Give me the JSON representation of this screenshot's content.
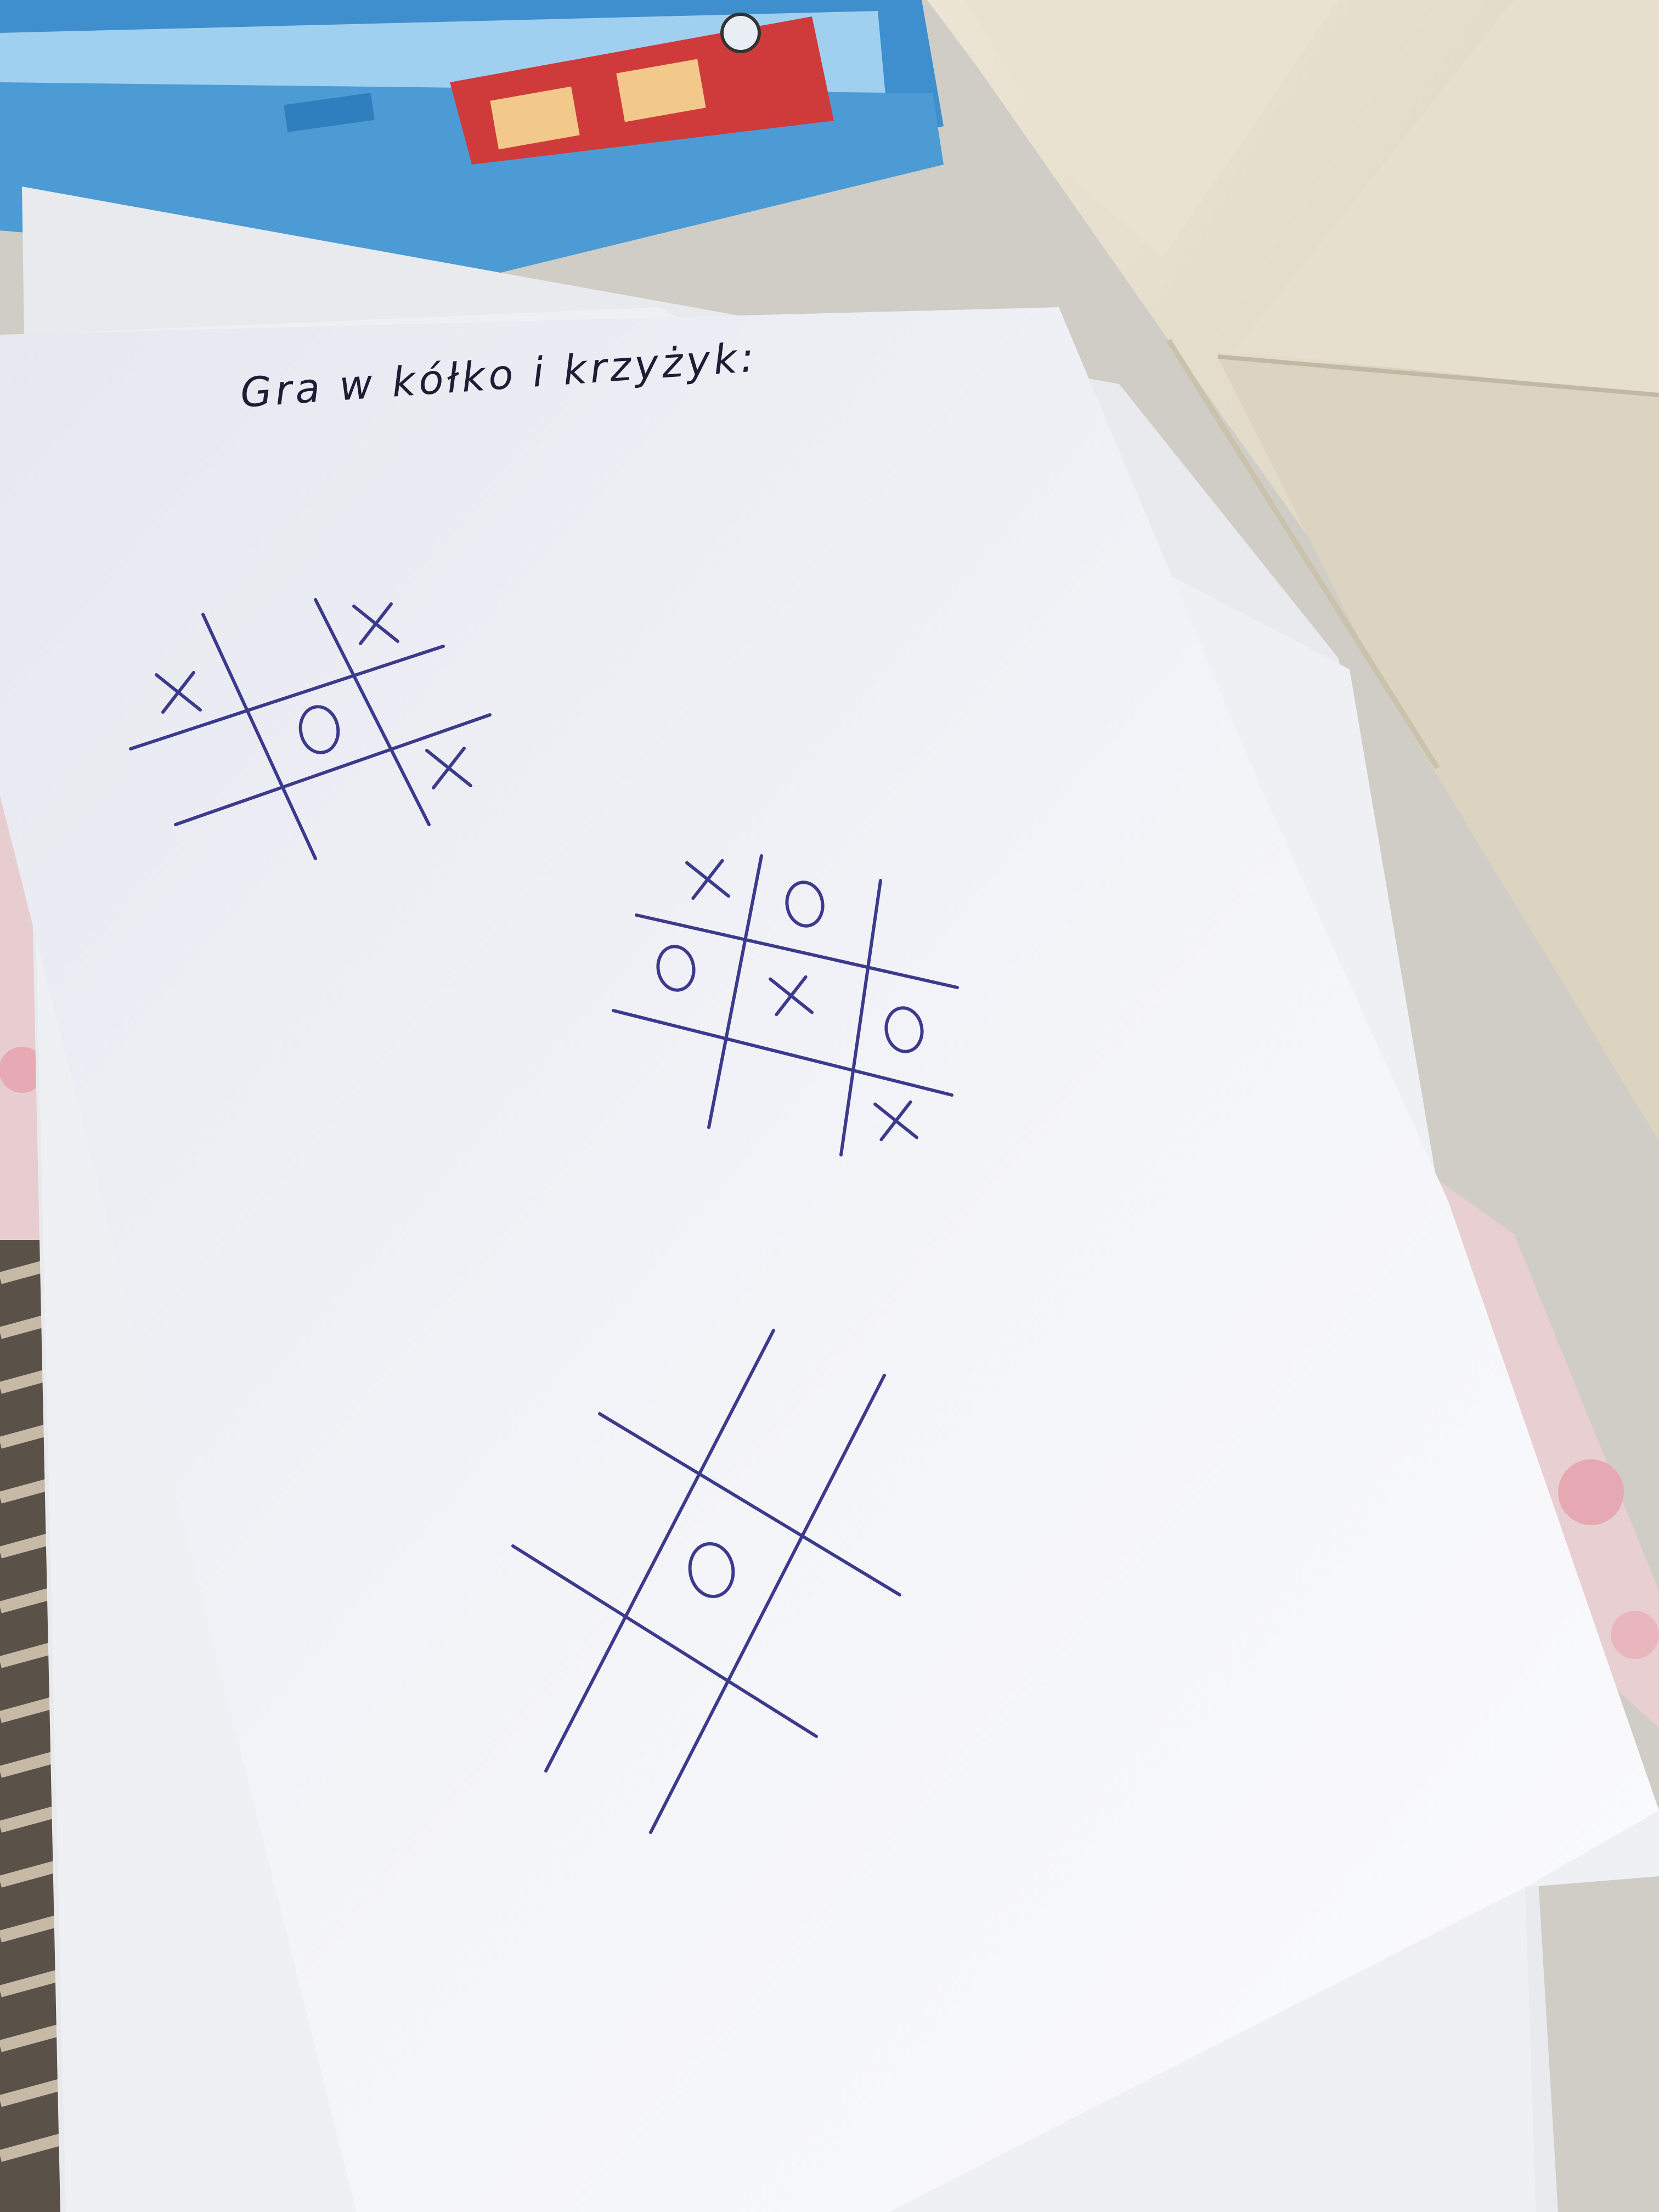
{
  "heading": "Gra w kółko i krzyżyk:",
  "colors": {
    "ink": "#3b3a8c",
    "paper": "#f2f3f8",
    "table": "#cfcdc6",
    "shelf": "#e3dccb",
    "box_blue": "#58a9d9",
    "house_red": "#cf3b3b"
  },
  "boards": [
    {
      "name": "board-top-left",
      "cells": [
        [
          "X",
          "",
          "X"
        ],
        [
          "",
          "O",
          ""
        ],
        [
          "",
          "",
          "X"
        ]
      ]
    },
    {
      "name": "board-middle",
      "cells": [
        [
          "X",
          "O",
          ""
        ],
        [
          "O",
          "X",
          "O"
        ],
        [
          "",
          "",
          "X"
        ]
      ]
    },
    {
      "name": "board-bottom",
      "cells": [
        [
          "",
          "",
          ""
        ],
        [
          "",
          "O",
          ""
        ],
        [
          "",
          "",
          ""
        ]
      ]
    }
  ]
}
